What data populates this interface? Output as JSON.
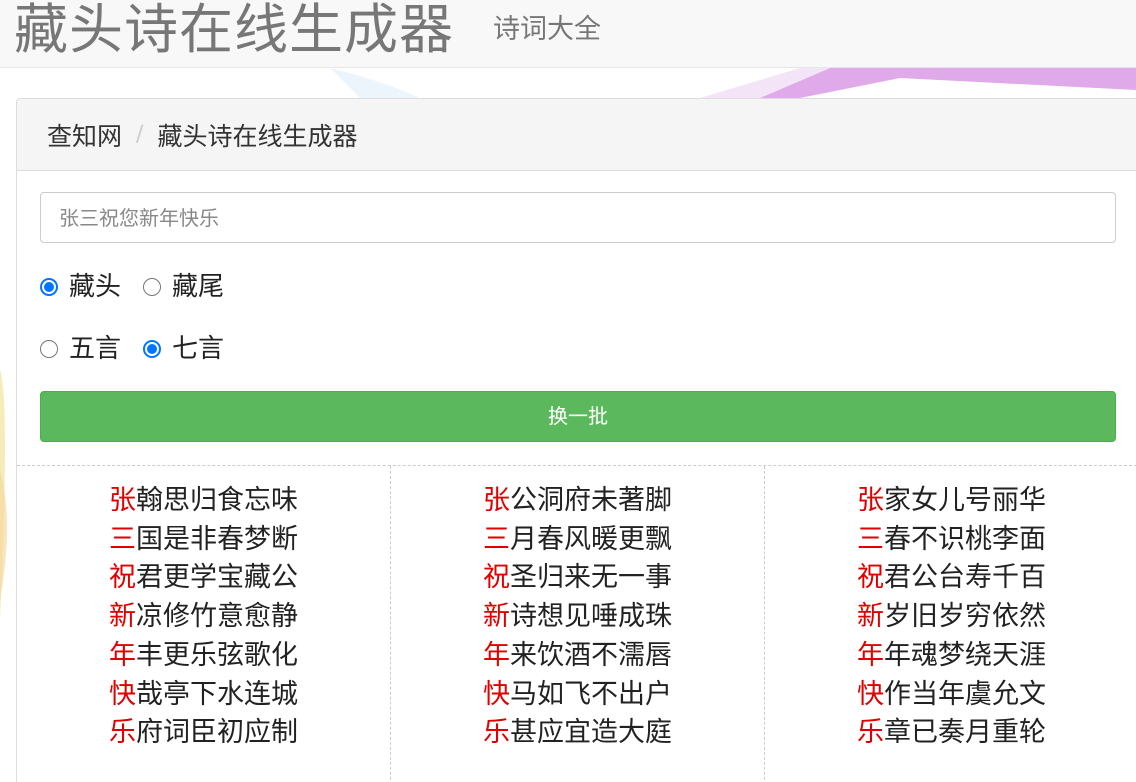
{
  "header": {
    "site_title": "藏头诗在线生成器",
    "nav_link": "诗词大全"
  },
  "breadcrumb": {
    "home": "查知网",
    "separator": "/",
    "current": "藏头诗在线生成器"
  },
  "input": {
    "placeholder": "张三祝您新年快乐",
    "value": ""
  },
  "mode_options": [
    {
      "label": "藏头",
      "checked": true
    },
    {
      "label": "藏尾",
      "checked": false
    }
  ],
  "length_options": [
    {
      "label": "五言",
      "checked": false
    },
    {
      "label": "七言",
      "checked": true
    }
  ],
  "refresh_button": {
    "label": "换一批"
  },
  "colors": {
    "button": "#5cb85c",
    "head_char": "#e00000",
    "radio": "#0075ff"
  },
  "poems": [
    {
      "lines": [
        {
          "head": "张",
          "rest": "翰思归食忘味"
        },
        {
          "head": "三",
          "rest": "国是非春梦断"
        },
        {
          "head": "祝",
          "rest": "君更学宝藏公"
        },
        {
          "head": "新",
          "rest": "凉修竹意愈静"
        },
        {
          "head": "年",
          "rest": "丰更乐弦歌化"
        },
        {
          "head": "快",
          "rest": "哉亭下水连城"
        },
        {
          "head": "乐",
          "rest": "府词臣初应制"
        }
      ]
    },
    {
      "lines": [
        {
          "head": "张",
          "rest": "公洞府未著脚"
        },
        {
          "head": "三",
          "rest": "月春风暖更飘"
        },
        {
          "head": "祝",
          "rest": "圣归来无一事"
        },
        {
          "head": "新",
          "rest": "诗想见唾成珠"
        },
        {
          "head": "年",
          "rest": "来饮酒不濡唇"
        },
        {
          "head": "快",
          "rest": "马如飞不出户"
        },
        {
          "head": "乐",
          "rest": "甚应宜造大庭"
        }
      ]
    },
    {
      "lines": [
        {
          "head": "张",
          "rest": "家女儿号丽华"
        },
        {
          "head": "三",
          "rest": "春不识桃李面"
        },
        {
          "head": "祝",
          "rest": "君公台寿千百"
        },
        {
          "head": "新",
          "rest": "岁旧岁穷依然"
        },
        {
          "head": "年",
          "rest": "年魂梦绕天涯"
        },
        {
          "head": "快",
          "rest": "作当年虞允文"
        },
        {
          "head": "乐",
          "rest": "章已奏月重轮"
        }
      ]
    }
  ]
}
